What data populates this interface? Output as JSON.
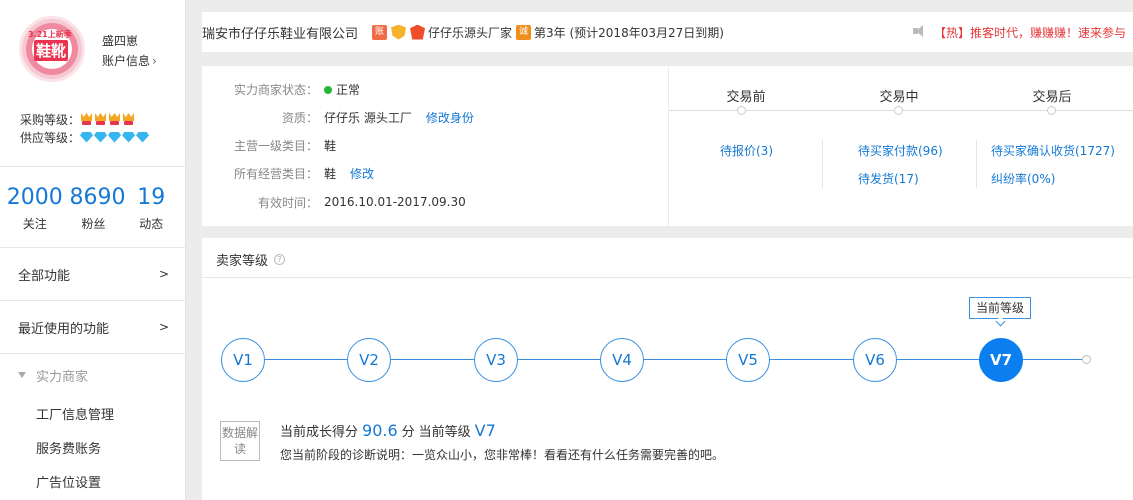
{
  "sidebar": {
    "avatar_text_top": "3.21上新季",
    "avatar_text_main": "鞋靴",
    "username": "盛四崽",
    "account_info": "账户信息",
    "purchase_level_label": "采购等级：",
    "supply_level_label": "供应等级：",
    "purchase_level_count": 4,
    "supply_level_count": 5,
    "stats": [
      {
        "value": "2000",
        "label": "关注"
      },
      {
        "value": "8690",
        "label": "粉丝"
      },
      {
        "value": "19",
        "label": "动态"
      }
    ],
    "menu": [
      {
        "label": "全部功能",
        "arrow": ">"
      },
      {
        "label": "最近使用的功能",
        "arrow": ">"
      }
    ],
    "section_title": "实力商家",
    "sub_items": [
      "工厂信息管理",
      "服务费账务",
      "广告位设置"
    ]
  },
  "topbar": {
    "company": "瑞安市仔仔乐鞋业有限公司",
    "badge_pay": "账",
    "badge_cheng": "诚",
    "brand": "仔仔乐源头厂家",
    "year_info": "第3年 (预计2018年03月27日到期)",
    "hot_notice": "【热】推客时代，赚赚赚！速来参与"
  },
  "info": {
    "rows": [
      {
        "key": "实力商家状态：",
        "value": "正常",
        "link": ""
      },
      {
        "key": "资质：",
        "value": "仔仔乐 源头工厂",
        "link": "修改身份"
      },
      {
        "key": "主营一级类目：",
        "value": "鞋",
        "link": ""
      },
      {
        "key": "所有经营类目：",
        "value": "鞋",
        "link": "修改"
      },
      {
        "key": "有效时间：",
        "value": "2016.10.01-2017.09.30",
        "link": ""
      }
    ]
  },
  "transactions": {
    "stages": [
      "交易前",
      "交易中",
      "交易后"
    ],
    "before": [
      "待报价(3)"
    ],
    "during": [
      "待买家付款(96)",
      "待发货(17)"
    ],
    "after": [
      "待买家确认收货(1727)",
      "纠纷率(0%)"
    ]
  },
  "seller_level": {
    "title": "卖家等级",
    "current_tag": "当前等级",
    "levels": [
      "V1",
      "V2",
      "V3",
      "V4",
      "V5",
      "V6",
      "V7"
    ],
    "current_index": 6,
    "data_box": "数据解读",
    "score_prefix": "当前成长得分",
    "score": "90.6",
    "score_unit": "分",
    "level_prefix": "当前等级",
    "current_level": "V7",
    "diagnosis": "您当前阶段的诊断说明：一览众山小，您非常棒！看看还有什么任务需要完善的吧。"
  },
  "colors": {
    "accent": "#1478d4",
    "current_level": "#0b7ff0",
    "hot": "#e4393c",
    "ok": "#25b93b"
  }
}
